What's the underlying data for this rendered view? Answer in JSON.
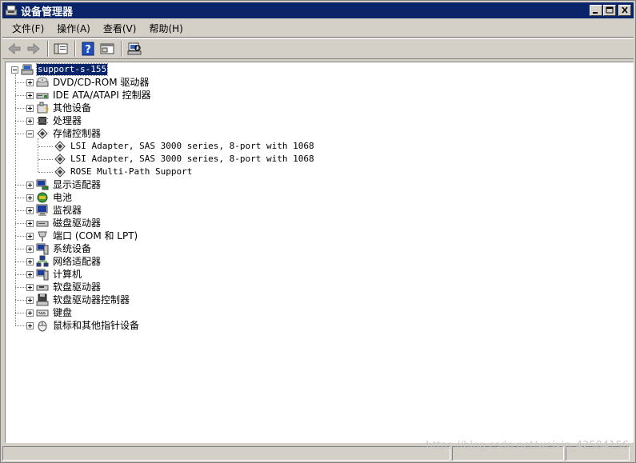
{
  "window": {
    "title": "设备管理器",
    "buttons": {
      "minimize": "_",
      "maximize": "□",
      "close": "×"
    }
  },
  "menu": [
    {
      "label": "文件(F)"
    },
    {
      "label": "操作(A)"
    },
    {
      "label": "查看(V)"
    },
    {
      "label": "帮助(H)"
    }
  ],
  "toolbar": {
    "icons": [
      "back-arrow-icon",
      "forward-arrow-icon",
      "show-hide-tree-icon",
      "help-icon",
      "properties-icon",
      "scan-hardware-icon"
    ]
  },
  "tree": {
    "root": {
      "label": "support-s-155",
      "selected": true
    },
    "categories": [
      {
        "label": "DVD/CD-ROM 驱动器",
        "icon": "dvd-drive-icon"
      },
      {
        "label": "IDE ATA/ATAPI 控制器",
        "icon": "ide-controller-icon"
      },
      {
        "label": "其他设备",
        "icon": "other-devices-icon"
      },
      {
        "label": "处理器",
        "icon": "processor-icon"
      },
      {
        "label": "存储控制器",
        "icon": "storage-controller-icon",
        "expanded": true,
        "children": [
          {
            "label": "LSI Adapter, SAS 3000 series, 8-port with 1068"
          },
          {
            "label": "LSI Adapter, SAS 3000 series, 8-port with 1068"
          },
          {
            "label": "ROSE Multi-Path Support"
          }
        ]
      },
      {
        "label": "显示适配器",
        "icon": "display-adapter-icon"
      },
      {
        "label": "电池",
        "icon": "battery-icon"
      },
      {
        "label": "监视器",
        "icon": "monitor-icon"
      },
      {
        "label": "磁盘驱动器",
        "icon": "disk-drive-icon"
      },
      {
        "label": "端口 (COM 和 LPT)",
        "icon": "port-icon"
      },
      {
        "label": "系统设备",
        "icon": "system-devices-icon"
      },
      {
        "label": "网络适配器",
        "icon": "network-adapter-icon"
      },
      {
        "label": "计算机",
        "icon": "computer-icon"
      },
      {
        "label": "软盘驱动器",
        "icon": "floppy-drive-icon"
      },
      {
        "label": "软盘驱动器控制器",
        "icon": "floppy-controller-icon"
      },
      {
        "label": "键盘",
        "icon": "keyboard-icon"
      },
      {
        "label": "鼠标和其他指针设备",
        "icon": "mouse-icon"
      }
    ]
  },
  "watermark": "https://blog.csdn.net/weixin_42584156",
  "colors": {
    "titlebar": "#0a246a",
    "selection": "#0a246a",
    "face": "#d4d0c8"
  }
}
